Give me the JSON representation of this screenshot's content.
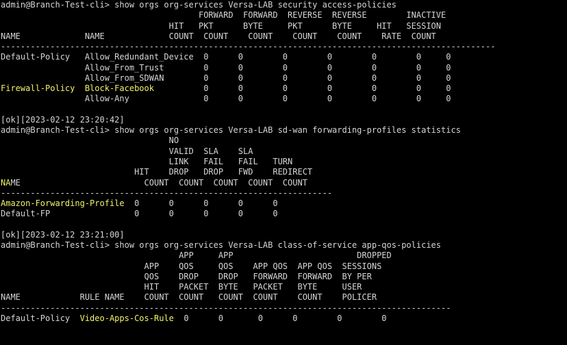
{
  "terminal": {
    "colors": {
      "background": "#000000",
      "foreground": "#d6d6d6",
      "highlight": "#f2f26a"
    },
    "lines": [
      {
        "segs": [
          {
            "t": "admin@Branch-Test-cli> show orgs org-services Versa-LAB security access-policies"
          }
        ]
      },
      {
        "segs": [
          {
            "t": "                                        FORWARD  FORWARD  REVERSE  REVERSE        INACTIVE"
          }
        ]
      },
      {
        "segs": [
          {
            "t": "                                  HIT   PKT      BYTE     PKT      BYTE     HIT   SESSION"
          }
        ]
      },
      {
        "segs": [
          {
            "t": "NAME             NAME             COUNT  COUNT    COUNT    COUNT    COUNT    RATE  COUNT"
          }
        ]
      },
      {
        "segs": [
          {
            "t": "----------------------------------------------------------------------------------------------------"
          }
        ]
      },
      {
        "segs": [
          {
            "t": "Default-Policy   Allow_Redundant_Device  0      0        0        0        0        0     0"
          }
        ]
      },
      {
        "segs": [
          {
            "t": "                 Allow_From_Trust        0      0        0        0        0        0     0"
          }
        ]
      },
      {
        "segs": [
          {
            "t": "                 Allow_From_SDWAN        0      0        0        0        0        0     0"
          }
        ]
      },
      {
        "segs": [
          {
            "t": "Firewall-Policy  Block-Facebook",
            "hl": true
          },
          {
            "t": "          0      0        0        0        0        0     0"
          }
        ]
      },
      {
        "segs": [
          {
            "t": "                 Allow-Any               0      0        0        0        0        0     0"
          }
        ]
      },
      {
        "segs": [
          {
            "t": ""
          }
        ]
      },
      {
        "segs": [
          {
            "t": "[ok][2023-02-12 23:20:42]"
          }
        ]
      },
      {
        "segs": [
          {
            "t": "admin@Branch-Test-cli> show orgs org-services Versa-LAB sd-wan forwarding-profiles statistics"
          }
        ]
      },
      {
        "segs": [
          {
            "t": "                                  NO"
          }
        ]
      },
      {
        "segs": [
          {
            "t": "                                  VALID  SLA    SLA"
          }
        ]
      },
      {
        "segs": [
          {
            "t": "                                  LINK   FAIL   FAIL   TURN"
          }
        ]
      },
      {
        "segs": [
          {
            "t": "                           HIT    DROP   DROP   FWD    REDIRECT"
          }
        ]
      },
      {
        "segs": [
          {
            "t": "NA",
            "hl": true
          },
          {
            "t": "ME                         COUNT  COUNT  COUNT  COUNT  COUNT"
          }
        ]
      },
      {
        "segs": [
          {
            "t": "-------------------------------------------------------------------"
          }
        ]
      },
      {
        "segs": [
          {
            "t": "Amazon-Forwarding-Profile",
            "hl": true
          },
          {
            "t": "  0      0      0      0      0"
          }
        ]
      },
      {
        "segs": [
          {
            "t": "Default-FP                 0      0      0      0      0"
          }
        ]
      },
      {
        "segs": [
          {
            "t": ""
          }
        ]
      },
      {
        "segs": [
          {
            "t": "[ok][2023-02-12 23:21:00]"
          }
        ]
      },
      {
        "segs": [
          {
            "t": "admin@Branch-Test-cli> show orgs org-services Versa-LAB class-of-service app-qos-policies"
          }
        ]
      },
      {
        "segs": [
          {
            "t": "                                    APP     APP                         DROPPED"
          }
        ]
      },
      {
        "segs": [
          {
            "t": "                             APP    QOS     QOS    APP QOS  APP QOS  SESSIONS"
          }
        ]
      },
      {
        "segs": [
          {
            "t": "                             QOS    DROP    DROP   FORWARD  FORWARD  BY PER"
          }
        ]
      },
      {
        "segs": [
          {
            "t": "                             HIT    PACKET  BYTE   PACKET   BYTE     USER"
          }
        ]
      },
      {
        "segs": [
          {
            "t": "NAME            RULE NAME    COUNT  COUNT   COUNT  COUNT    COUNT    POLICER"
          }
        ]
      },
      {
        "segs": [
          {
            "t": "-------------------------------------------------------------------------------------------"
          }
        ]
      },
      {
        "segs": [
          {
            "t": "Default-Policy  "
          },
          {
            "t": "Video-Apps-Cos-Rule",
            "hl": true
          },
          {
            "t": "  0      0       0      0        0        0"
          }
        ]
      },
      {
        "segs": [
          {
            "t": ""
          }
        ]
      }
    ]
  }
}
